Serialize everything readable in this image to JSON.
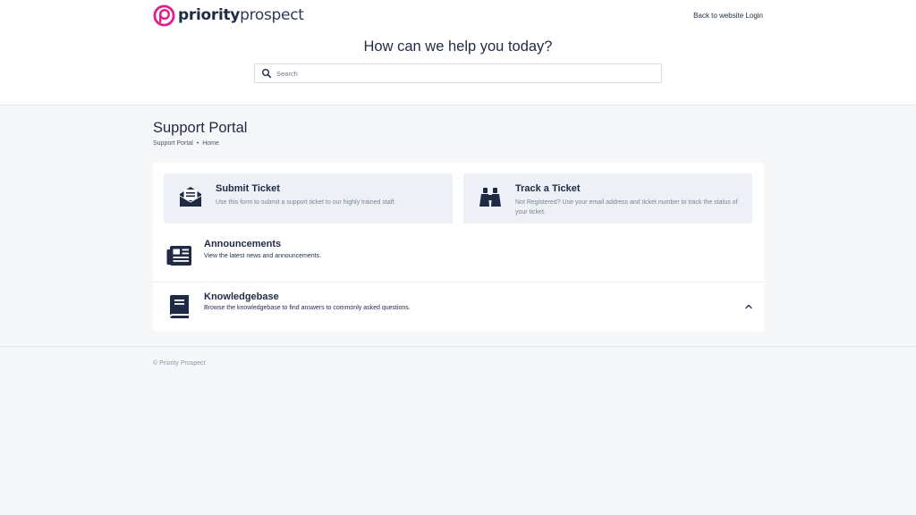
{
  "header": {
    "logo_bold": "priority",
    "logo_light": "prospect",
    "logo_icon": "priority-prospect-logo-icon",
    "back_link": "Back to website Login"
  },
  "hero": {
    "title": "How can we help you today?",
    "search_placeholder": "Search",
    "search_icon": "search-icon"
  },
  "portal": {
    "title": "Support Portal",
    "breadcrumb": [
      "Support Portal",
      "Home"
    ],
    "breadcrumb_separator": "•"
  },
  "cards": [
    {
      "title": "Submit Ticket",
      "description": "Use this form to submit a support ticket to our highly trained staff.",
      "icon": "envelope-open-icon"
    },
    {
      "title": "Track a Ticket",
      "description": "Not Registered? Use your email address and ticket number to track the status of your ticket.",
      "icon": "binoculars-icon"
    }
  ],
  "rows": [
    {
      "title": "Announcements",
      "description": "View the latest news and announcements.",
      "icon": "newspaper-icon"
    },
    {
      "title": "Knowledgebase",
      "description": "Browse the knowledgebase to find answers to commonly asked questions.",
      "icon": "book-icon",
      "toggle_icon": "chevron-up-icon"
    }
  ],
  "footer": {
    "copyright": "© Priority Prospect"
  },
  "colors": {
    "brand_pink": "#e0218a",
    "navy": "#1f2a44",
    "card_bg": "#edf1f6",
    "page_bg": "#f6f7f9"
  }
}
